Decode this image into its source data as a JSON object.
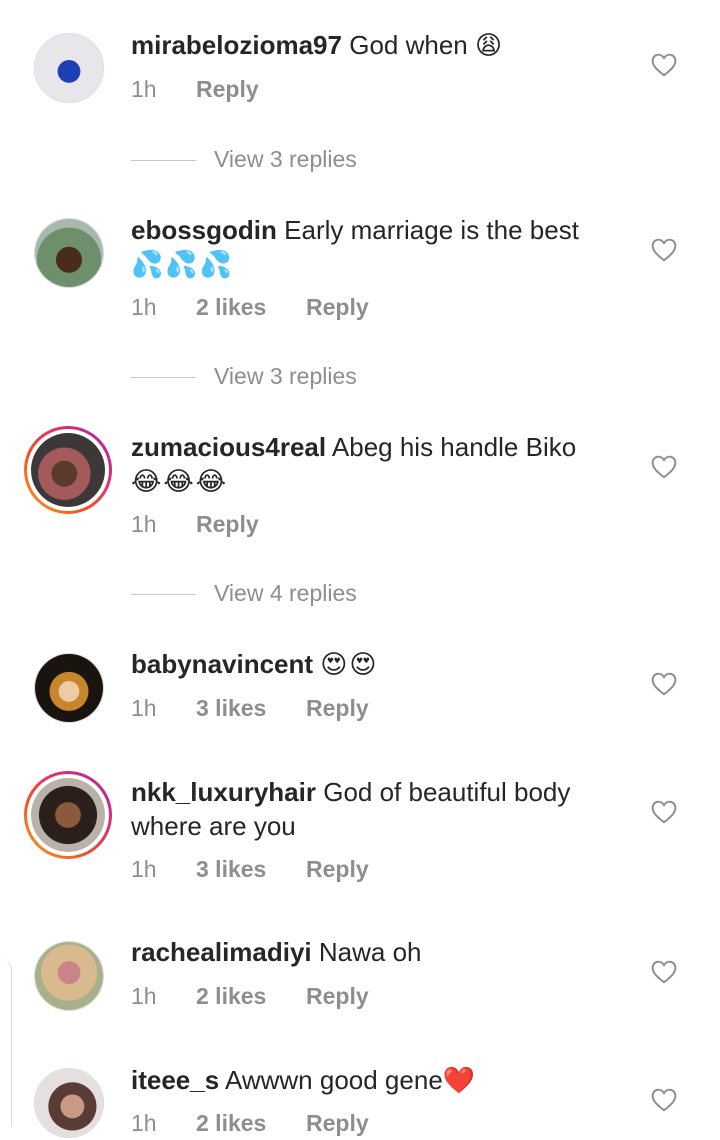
{
  "comments": [
    {
      "username": "mirabelozioma97",
      "text": "God when",
      "emoji": "😩",
      "time": "1h",
      "likes": "",
      "reply": "Reply"
    },
    {
      "username": "ebossgodin",
      "text": "Early marriage is the best",
      "emoji": "💦💦💦",
      "time": "1h",
      "likes": "2 likes",
      "reply": "Reply"
    },
    {
      "username": "zumacious4real",
      "text": "Abeg his handle Biko",
      "emoji": "😂😂😂",
      "time": "1h",
      "likes": "",
      "reply": "Reply"
    },
    {
      "username": "babynavincent",
      "text": "",
      "emoji": "😍😍",
      "time": "1h",
      "likes": "3 likes",
      "reply": "Reply"
    },
    {
      "username": "nkk_luxuryhair",
      "text": "God of beautiful body where are you",
      "emoji": "",
      "time": "1h",
      "likes": "3 likes",
      "reply": "Reply"
    },
    {
      "username": "rachealimadiyi",
      "text": "Nawa oh",
      "emoji": "",
      "time": "1h",
      "likes": "2 likes",
      "reply": "Reply"
    },
    {
      "username": "iteee_s",
      "text": "Awwwn good gene",
      "emoji": "❤️",
      "time": "1h",
      "likes": "2 likes",
      "reply": "Reply"
    }
  ],
  "view_replies": [
    "View 3 replies",
    "View 3 replies",
    "View 4 replies"
  ],
  "colors": {
    "text": "#262626",
    "secondary": "#8e8e8e",
    "divider": "#c7c7c7",
    "story_ring_start": "#f9a825",
    "story_ring_end": "#9c27b0"
  },
  "icons": {
    "like": "heart-outline-icon"
  }
}
